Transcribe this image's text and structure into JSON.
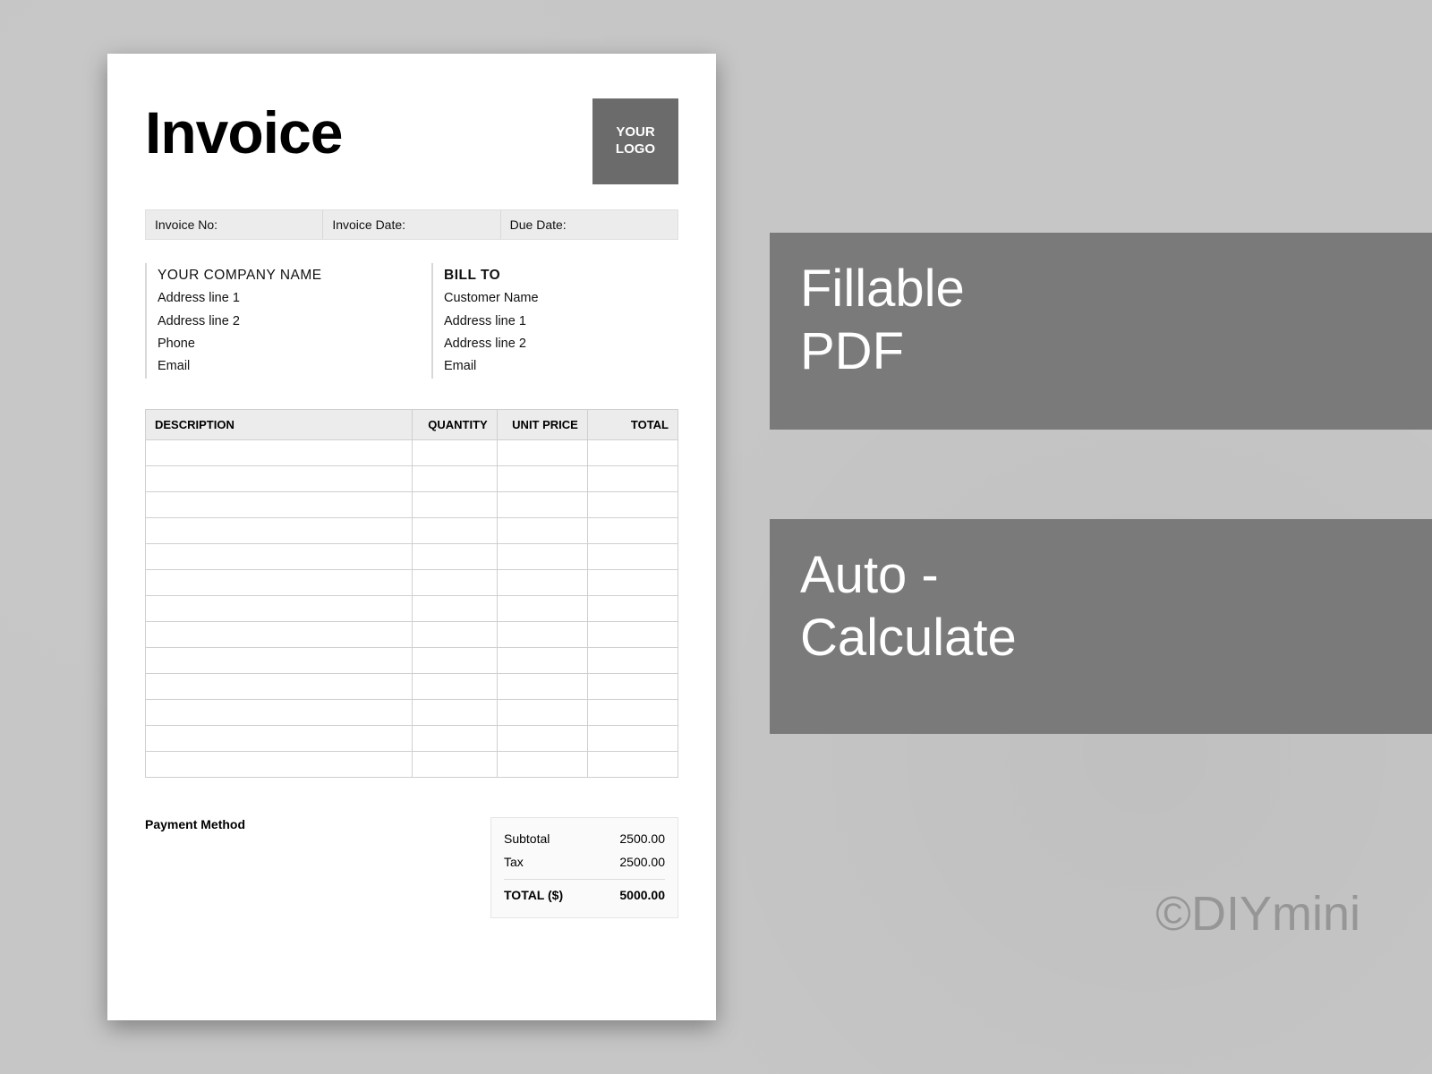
{
  "title": "Invoice",
  "logo": {
    "line1": "YOUR",
    "line2": "LOGO"
  },
  "meta": {
    "invoice_no_label": "Invoice No:",
    "invoice_date_label": "Invoice Date:",
    "due_date_label": "Due Date:"
  },
  "from": {
    "heading": "YOUR COMPANY NAME",
    "address1": "Address line 1",
    "address2": "Address line 2",
    "phone": "Phone",
    "email": "Email"
  },
  "bill_to": {
    "heading": "BILL TO",
    "customer": "Customer Name",
    "address1": "Address line 1",
    "address2": "Address line 2",
    "email": "Email"
  },
  "columns": {
    "description": "DESCRIPTION",
    "quantity": "QUANTITY",
    "unit_price": "UNIT PRICE",
    "total": "TOTAL"
  },
  "row_count": 13,
  "payment_method_label": "Payment Method",
  "totals": {
    "subtotal_label": "Subtotal",
    "subtotal_value": "2500.00",
    "tax_label": "Tax",
    "tax_value": "2500.00",
    "total_label": "TOTAL ($)",
    "total_value": "5000.00"
  },
  "banners": {
    "fillable_line1": "Fillable",
    "fillable_line2": "PDF",
    "auto_line1": "Auto -",
    "auto_line2": "Calculate"
  },
  "brand_credit": "©DIYmini"
}
